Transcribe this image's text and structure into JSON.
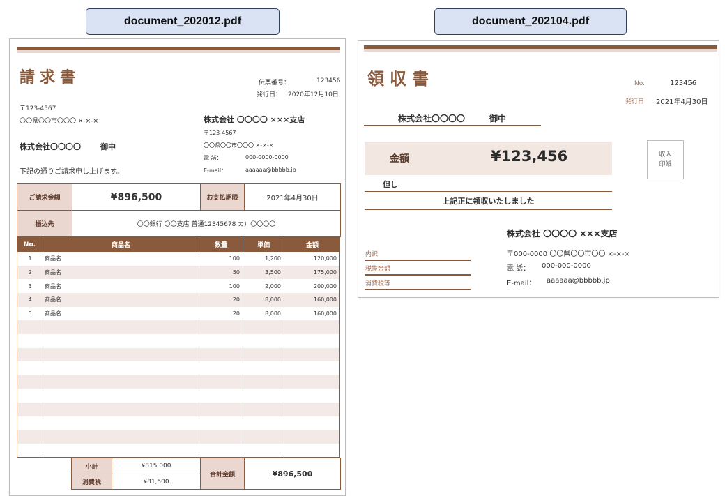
{
  "files": {
    "left": "document_202012.pdf",
    "right": "document_202104.pdf"
  },
  "invoice": {
    "title": "請求書",
    "slip_label": "伝票番号：",
    "slip_no": "123456",
    "issue_label": "発行日：",
    "issue_date": "2020年12月10日",
    "recipient": {
      "postal": "〒123-4567",
      "address": "〇〇県〇〇市〇〇〇 ×-×-×",
      "company": "株式会社〇〇〇〇",
      "honorific": "御中"
    },
    "message": "下記の通りご請求申し上げます。",
    "issuer": {
      "company": "株式会社 〇〇〇〇 ×××支店",
      "postal": "〒123-4567",
      "address": "〇〇県〇〇市〇〇〇 ×-×-×",
      "tel_label": "電 話：",
      "tel": "000-0000-0000",
      "email_label": "E-mail：",
      "email": "aaaaaa@bbbbb.jp"
    },
    "summary": {
      "amount_label": "ご請求金額",
      "amount": "¥896,500",
      "due_label": "お支払期限",
      "due_date": "2021年4月30日",
      "transfer_label": "振込先",
      "transfer": "〇〇銀行 〇〇支店 普通12345678 カ）〇〇〇〇"
    },
    "table": {
      "headers": [
        "No.",
        "商品名",
        "数量",
        "単価",
        "金額"
      ],
      "rows": [
        [
          "1",
          "商品名",
          "100",
          "1,200",
          "120,000"
        ],
        [
          "2",
          "商品名",
          "50",
          "3,500",
          "175,000"
        ],
        [
          "3",
          "商品名",
          "100",
          "2,000",
          "200,000"
        ],
        [
          "4",
          "商品名",
          "20",
          "8,000",
          "160,000"
        ],
        [
          "5",
          "商品名",
          "20",
          "8,000",
          "160,000"
        ],
        [
          "",
          "",
          "",
          "",
          ""
        ],
        [
          "",
          "",
          "",
          "",
          ""
        ],
        [
          "",
          "",
          "",
          "",
          ""
        ],
        [
          "",
          "",
          "",
          "",
          ""
        ],
        [
          "",
          "",
          "",
          "",
          ""
        ],
        [
          "",
          "",
          "",
          "",
          ""
        ],
        [
          "",
          "",
          "",
          "",
          ""
        ],
        [
          "",
          "",
          "",
          "",
          ""
        ],
        [
          "",
          "",
          "",
          "",
          ""
        ],
        [
          "",
          "",
          "",
          "",
          ""
        ]
      ]
    },
    "totals": {
      "subtotal_label": "小計",
      "subtotal": "¥815,000",
      "tax_label": "消費税",
      "tax": "¥81,500",
      "grand_label": "合計金額",
      "grand": "¥896,500"
    }
  },
  "receipt": {
    "title": "領収書",
    "no_label": "No.",
    "no": "123456",
    "issue_label": "発行日",
    "issue_date": "2021年4月30日",
    "recipient": "株式会社〇〇〇〇",
    "honorific": "御中",
    "amount_label": "金額",
    "amount": "¥123,456",
    "note_label": "但し",
    "confirm": "上記正に領収いたしました",
    "stamp_line1": "収入",
    "stamp_line2": "印紙",
    "issuer": {
      "company": "株式会社 〇〇〇〇 ×××支店",
      "address": "〒000-0000 〇〇県〇〇市〇〇 ×-×-×",
      "tel_label": "電 話：",
      "tel": "000-000-0000",
      "email_label": "E-mail：",
      "email": "aaaaaa@bbbbb.jp"
    },
    "breakdown": [
      "内訳",
      "税抜金額",
      "消費税等"
    ]
  },
  "colors": {
    "accent": "#8a5a3c",
    "accent_light": "#ead7d0",
    "label_bg": "#dae3f3"
  }
}
